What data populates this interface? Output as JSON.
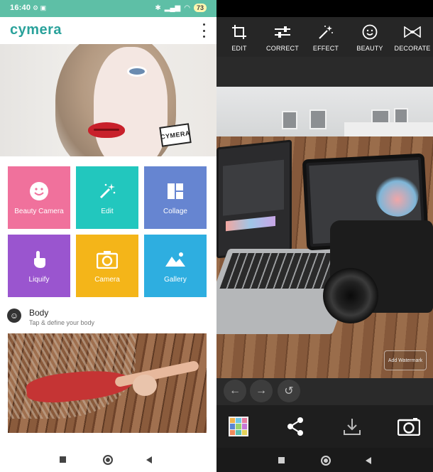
{
  "left_app": {
    "status_time": "16:40",
    "battery": "73",
    "logo": "cymera",
    "hero_tag": "CYMERA",
    "tiles": [
      {
        "label": "Beauty Camera",
        "icon": "smile-icon",
        "color": "#f0719c"
      },
      {
        "label": "Edit",
        "icon": "magic-wand-icon",
        "color": "#22c7be"
      },
      {
        "label": "Collage",
        "icon": "collage-grid-icon",
        "color": "#6685d1"
      },
      {
        "label": "Liquify",
        "icon": "finger-touch-icon",
        "color": "#9a55cf"
      },
      {
        "label": "Camera",
        "icon": "camera-icon",
        "color": "#f4b519"
      },
      {
        "label": "Gallery",
        "icon": "gallery-image-icon",
        "color": "#2eaee0"
      }
    ],
    "body_section": {
      "title": "Body",
      "subtitle": "Tap & define your body"
    }
  },
  "right_app": {
    "tools": [
      {
        "label": "EDIT",
        "icon": "crop-icon"
      },
      {
        "label": "CORRECT",
        "icon": "sliders-icon"
      },
      {
        "label": "EFFECT",
        "icon": "sparkle-icon"
      },
      {
        "label": "BEAUTY",
        "icon": "smile-icon"
      },
      {
        "label": "DECORATE",
        "icon": "bow-tie-icon"
      }
    ],
    "watermark_label": "Add Watermark"
  }
}
